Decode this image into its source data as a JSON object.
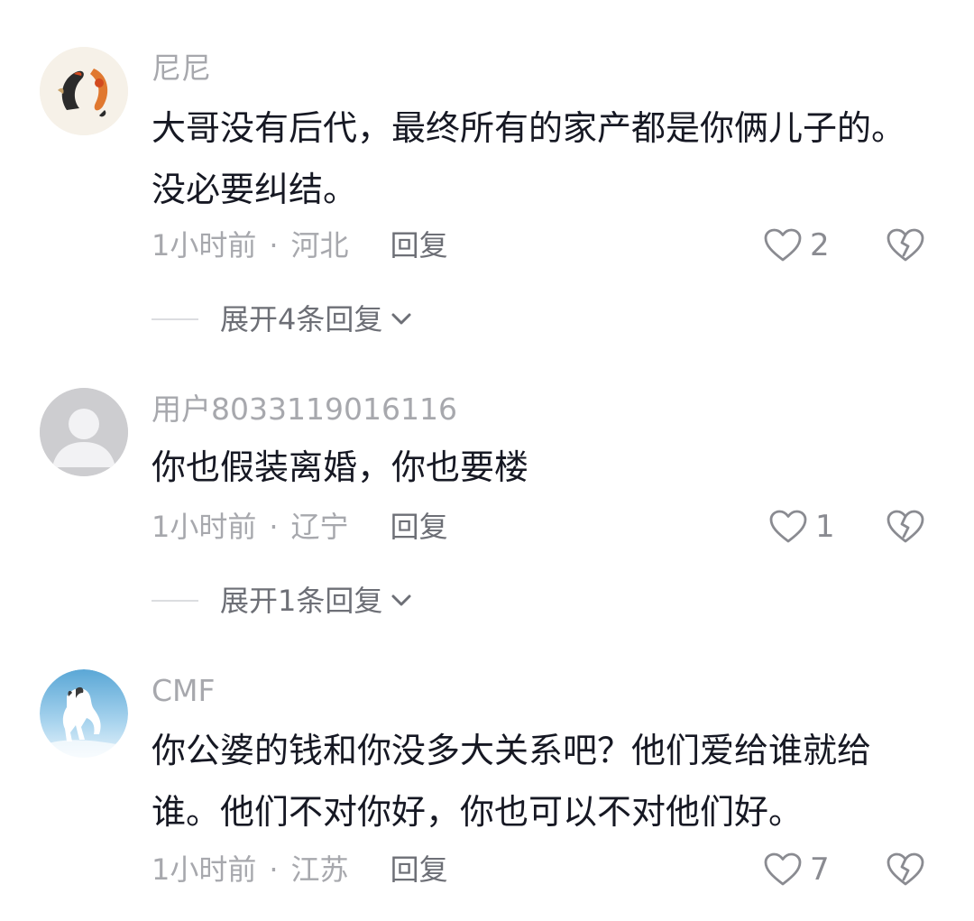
{
  "comments": [
    {
      "username": "尼尼",
      "text": "大哥没有后代，最终所有的家产都是你俩儿子的。没必要纠结。",
      "time": "1小时前",
      "location": "河北",
      "reply_label": "回复",
      "likes": "2",
      "expand_label": "展开4条回复",
      "avatar_icon": "koi-fish-avatar"
    },
    {
      "username": "用户8033119016116",
      "text": "你也假装离婚，你也要楼",
      "time": "1小时前",
      "location": "辽宁",
      "reply_label": "回复",
      "likes": "1",
      "expand_label": "展开1条回复",
      "avatar_icon": "default-user-avatar"
    },
    {
      "username": "CMF",
      "text": "你公婆的钱和你没多大关系吧？他们爱给谁就给谁。他们不对你好，你也可以不对他们好。",
      "time": "1小时前",
      "location": "江苏",
      "reply_label": "回复",
      "likes": "7",
      "avatar_icon": "white-horse-avatar"
    }
  ],
  "separator": "·",
  "icons": {
    "like": "heart-outline-icon",
    "dislike": "broken-heart-icon",
    "expand": "chevron-down-icon"
  },
  "colors": {
    "text": "#161823",
    "muted": "#a7a8ad",
    "reply": "#6d6f76"
  }
}
